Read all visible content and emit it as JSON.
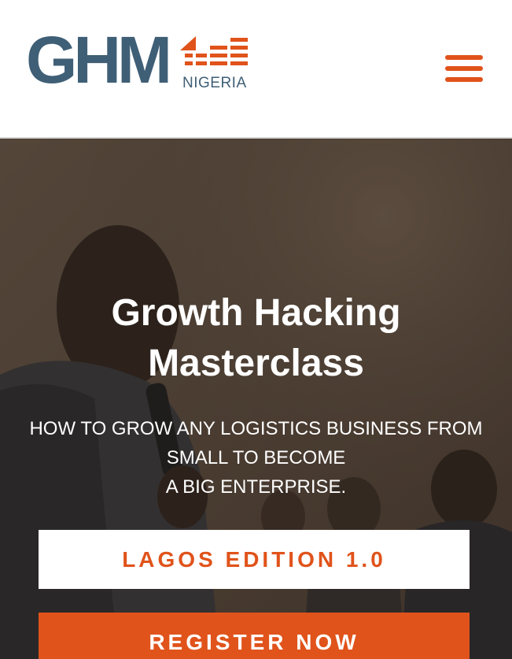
{
  "header": {
    "logo": {
      "letters": "GHM",
      "country": "NIGERIA",
      "icon": "ghm-nigeria-logo"
    },
    "menu_icon": "hamburger-menu-icon"
  },
  "hero": {
    "background": "photo-speaker-with-microphone",
    "title_lines": [
      "Growth Hacking",
      "Masterclass"
    ],
    "subtitle_lines": [
      "HOW TO GROW ANY LOGISTICS BUSINESS FROM",
      "SMALL TO BECOME",
      "A BIG ENTERPRISE."
    ],
    "edition_label": "LAGOS EDITION 1.0",
    "register_label": "REGISTER NOW"
  },
  "colors": {
    "accent": "#e0531b",
    "brand_blue": "#3f5f76",
    "white": "#ffffff"
  }
}
